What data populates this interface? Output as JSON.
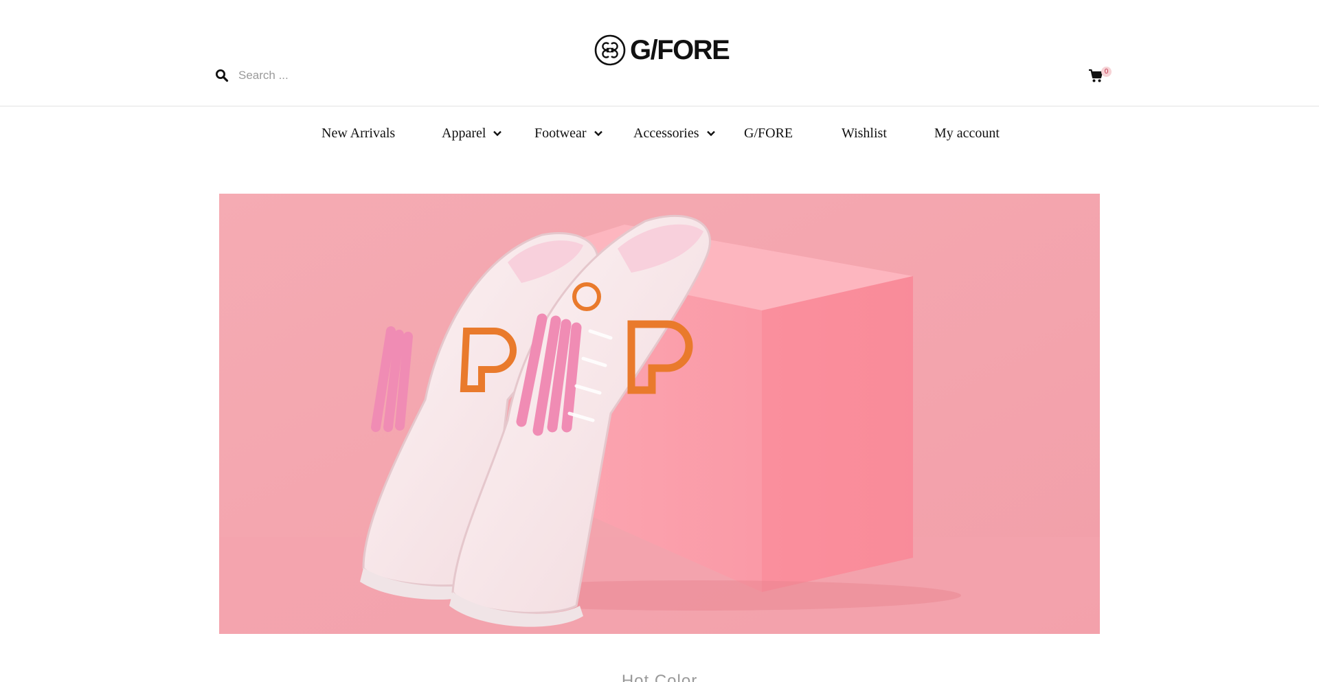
{
  "brand": {
    "logo_text": "G/FORE"
  },
  "search": {
    "placeholder": "Search ..."
  },
  "cart": {
    "count": "0",
    "icon": "cart-icon"
  },
  "nav": {
    "items": [
      {
        "label": "New Arrivals",
        "has_dropdown": false
      },
      {
        "label": "Apparel",
        "has_dropdown": true
      },
      {
        "label": "Footwear",
        "has_dropdown": true
      },
      {
        "label": "Accessories",
        "has_dropdown": true
      },
      {
        "label": "G/FORE",
        "has_dropdown": false
      },
      {
        "label": "Wishlist",
        "has_dropdown": false
      },
      {
        "label": "My account",
        "has_dropdown": false
      }
    ]
  },
  "hero": {
    "background_color": "#f4a6ae",
    "box_color": "#fb9aa6",
    "accent_color": "#e97a2c",
    "tassel_color": "#f08cb4"
  },
  "section": {
    "title": "Hot Color"
  }
}
